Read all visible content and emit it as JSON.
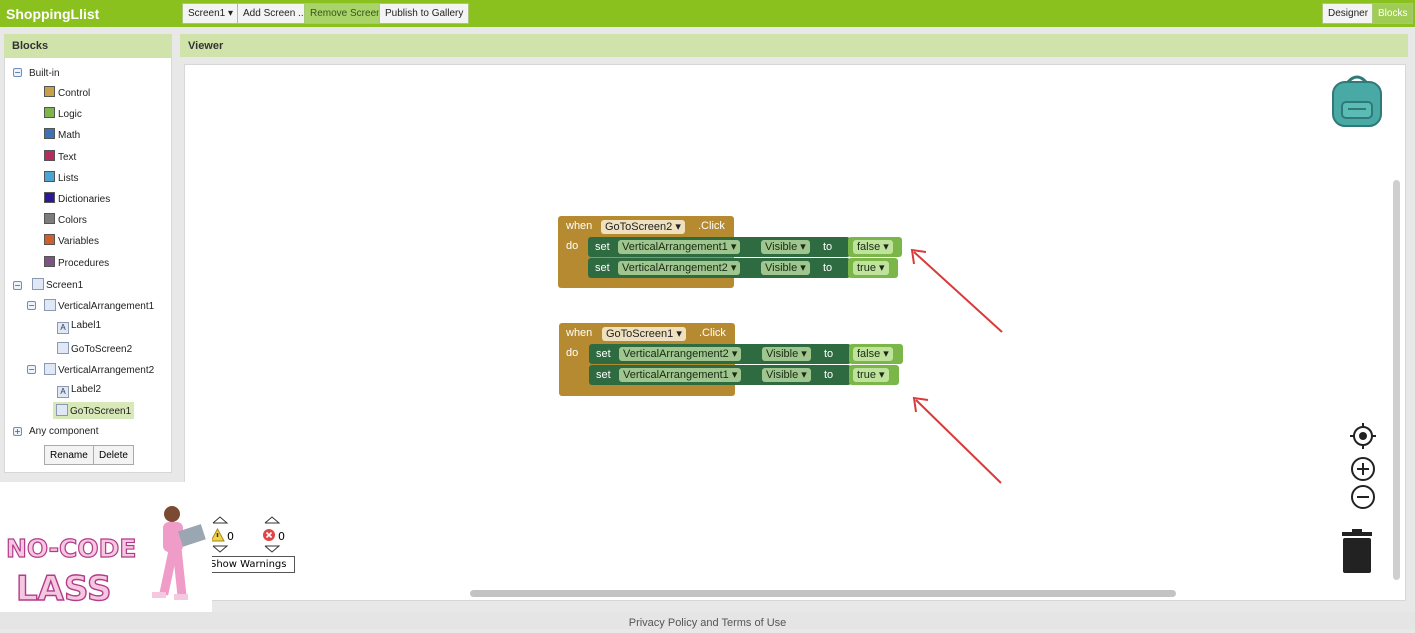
{
  "app": {
    "title": "ShoppingLlist"
  },
  "toolbar": {
    "screen_select": "Screen1 ▾",
    "add_screen": "Add Screen ...",
    "remove_screen": "Remove Screen",
    "publish": "Publish to Gallery",
    "designer": "Designer",
    "blocks": "Blocks"
  },
  "blocks_panel": {
    "title": "Blocks",
    "builtin_label": "Built-in",
    "builtin_items": [
      {
        "label": "Control",
        "color": "#c8a04a"
      },
      {
        "label": "Logic",
        "color": "#7ab648"
      },
      {
        "label": "Math",
        "color": "#3f71b5"
      },
      {
        "label": "Text",
        "color": "#b32d5e"
      },
      {
        "label": "Lists",
        "color": "#49a6d4"
      },
      {
        "label": "Dictionaries",
        "color": "#2d1799"
      },
      {
        "label": "Colors",
        "color": "#7d7d7d"
      },
      {
        "label": "Variables",
        "color": "#d05f2d"
      },
      {
        "label": "Procedures",
        "color": "#7c5385"
      }
    ],
    "screen_label": "Screen1",
    "va1_label": "VerticalArrangement1",
    "label1": "Label1",
    "goto2": "GoToScreen2",
    "va2_label": "VerticalArrangement2",
    "label2": "Label2",
    "goto1": "GoToScreen1",
    "any_component": "Any component",
    "rename": "Rename",
    "delete": "Delete"
  },
  "viewer": {
    "title": "Viewer",
    "block1": {
      "when": "when",
      "component": "GoToScreen2",
      "event": ".Click",
      "do": "do",
      "rows": [
        {
          "set": "set",
          "target": "VerticalArrangement1",
          "prop": "Visible",
          "to": "to",
          "value": "false"
        },
        {
          "set": "set",
          "target": "VerticalArrangement2",
          "prop": "Visible",
          "to": "to",
          "value": "true"
        }
      ]
    },
    "block2": {
      "when": "when",
      "component": "GoToScreen1",
      "event": ".Click",
      "do": "do",
      "rows": [
        {
          "set": "set",
          "target": "VerticalArrangement2",
          "prop": "Visible",
          "to": "to",
          "value": "false"
        },
        {
          "set": "set",
          "target": "VerticalArrangement1",
          "prop": "Visible",
          "to": "to",
          "value": "true"
        }
      ]
    },
    "warnings_count": "0",
    "errors_count": "0",
    "show_warnings": "Show Warnings"
  },
  "footer": {
    "text": "Privacy Policy and Terms of Use"
  },
  "logo": {
    "line1": "NO-CODE",
    "line2": "LASS"
  }
}
